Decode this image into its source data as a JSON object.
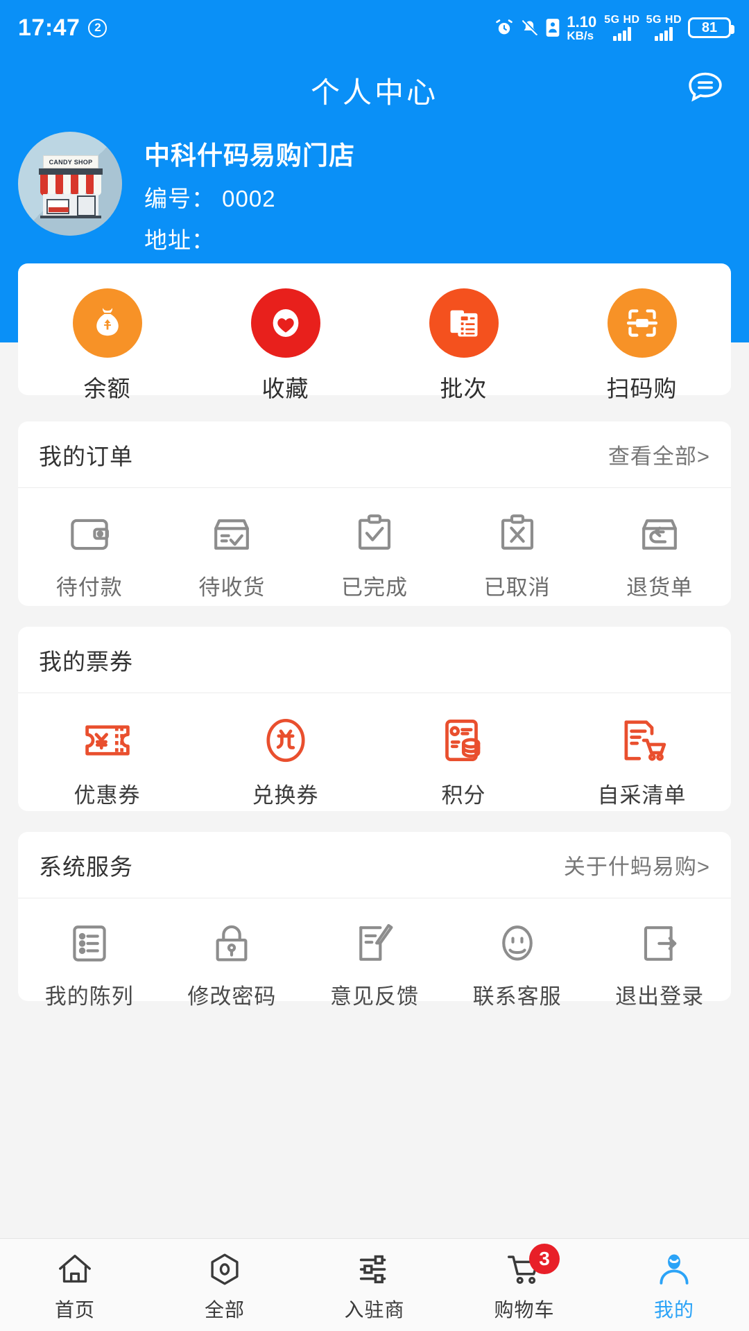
{
  "statusbar": {
    "time": "17:47",
    "badge": "2",
    "net_speed_value": "1.10",
    "net_speed_unit": "KB/s",
    "sim1_label": "5G HD",
    "sim2_label": "5G HD",
    "battery": "81",
    "icons": [
      "alarm-icon",
      "mute-icon",
      "vcard-icon"
    ]
  },
  "navbar": {
    "title": "个人中心",
    "message_icon": "message-bubble-icon"
  },
  "store": {
    "avatar_sign": "CANDY SHOP",
    "name": "中科什码易购门店",
    "code_line": "编号： 0002",
    "address_line": "地址："
  },
  "quick_actions": {
    "items": [
      {
        "label": "余额",
        "icon": "money-bag-icon",
        "color": "#F79227"
      },
      {
        "label": "收藏",
        "icon": "heart-icon",
        "color": "#E8201C"
      },
      {
        "label": "批次",
        "icon": "batch-list-icon",
        "color": "#F4511E"
      },
      {
        "label": "扫码购",
        "icon": "scan-code-icon",
        "color": "#F79227"
      }
    ]
  },
  "orders": {
    "title": "我的订单",
    "link": "查看全部>",
    "items": [
      {
        "label": "待付款",
        "icon": "wallet-icon"
      },
      {
        "label": "待收货",
        "icon": "package-check-icon"
      },
      {
        "label": "已完成",
        "icon": "clipboard-check-icon"
      },
      {
        "label": "已取消",
        "icon": "clipboard-x-icon"
      },
      {
        "label": "退货单",
        "icon": "return-box-icon"
      }
    ]
  },
  "coupons": {
    "title": "我的票券",
    "items": [
      {
        "label": "优惠券",
        "icon": "coupon-ticket-icon"
      },
      {
        "label": "兑换券",
        "icon": "exchange-coupon-icon"
      },
      {
        "label": "积分",
        "icon": "points-card-icon"
      },
      {
        "label": "自采清单",
        "icon": "purchase-list-icon"
      }
    ]
  },
  "services": {
    "title": "系统服务",
    "link": "关于什蚂易购>",
    "items": [
      {
        "label": "我的陈列",
        "icon": "list-icon"
      },
      {
        "label": "修改密码",
        "icon": "lock-icon"
      },
      {
        "label": "意见反馈",
        "icon": "feedback-edit-icon"
      },
      {
        "label": "联系客服",
        "icon": "smiley-face-icon"
      },
      {
        "label": "退出登录",
        "icon": "logout-icon"
      }
    ]
  },
  "tabbar": {
    "items": [
      {
        "label": "首页",
        "icon": "home-icon",
        "active": false
      },
      {
        "label": "全部",
        "icon": "hexagon-icon",
        "active": false
      },
      {
        "label": "入驻商",
        "icon": "sliders-icon",
        "active": false
      },
      {
        "label": "购物车",
        "icon": "cart-icon",
        "active": false,
        "badge": "3"
      },
      {
        "label": "我的",
        "icon": "person-icon",
        "active": true
      }
    ]
  },
  "colors": {
    "brand_blue": "#0a90f7",
    "page_bg": "#f4f4f4",
    "accent_red": "#e8201c",
    "accent_orange": "#f79227",
    "coupon_red": "#e94f2e",
    "active_tab": "#2ba3f7"
  }
}
